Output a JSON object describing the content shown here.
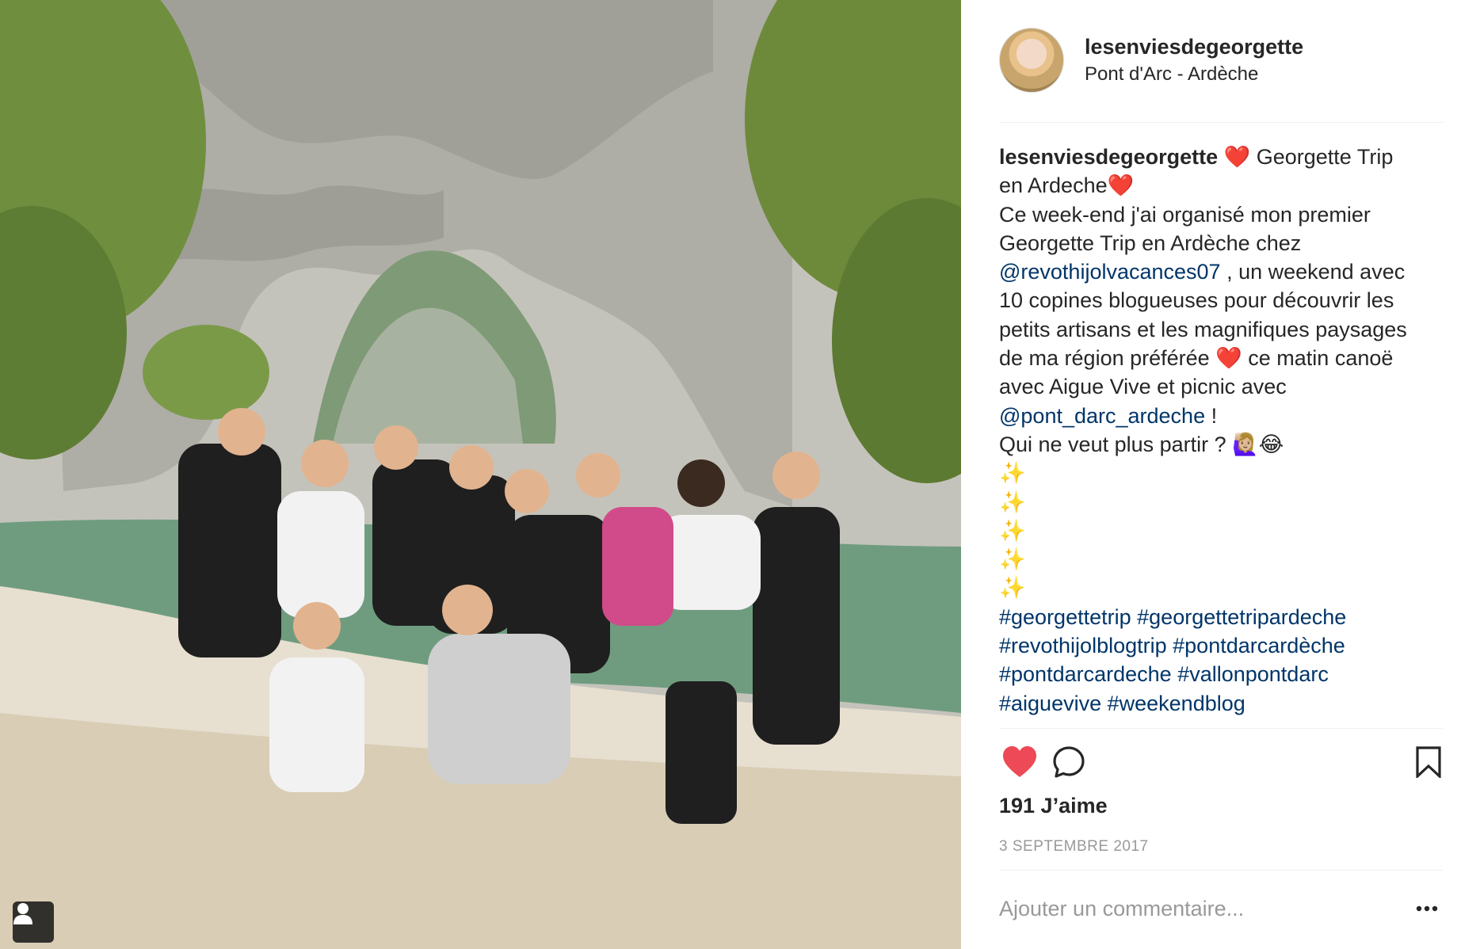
{
  "post": {
    "username": "lesenviesdegeorgette",
    "location": "Pont d'Arc - Ardèche",
    "caption": {
      "lines": [
        [
          {
            "t": "lesenviesdegeorgette",
            "k": "user"
          },
          {
            "t": " ❤️ Georgette Trip"
          }
        ],
        [
          {
            "t": "en Ardeche❤️"
          }
        ],
        [
          {
            "t": "Ce week-end j'ai organisé mon premier"
          }
        ],
        [
          {
            "t": "Georgette Trip en Ardèche chez"
          }
        ],
        [
          {
            "t": "@revothijolvacances07",
            "k": "link"
          },
          {
            "t": " , un weekend avec"
          }
        ],
        [
          {
            "t": "10 copines blogueuses pour découvrir les"
          }
        ],
        [
          {
            "t": "petits artisans et les magnifiques paysages"
          }
        ],
        [
          {
            "t": "de ma région préférée ❤️ ce matin canoë"
          }
        ],
        [
          {
            "t": "avec Aigue Vive et picnic avec"
          }
        ],
        [
          {
            "t": "@pont_darc_ardeche",
            "k": "link"
          },
          {
            "t": " !"
          }
        ],
        [
          {
            "t": "Qui ne veut plus partir ? 🙋🏼‍♀️😂"
          }
        ],
        [
          {
            "t": "✨"
          }
        ],
        [
          {
            "t": "✨"
          }
        ],
        [
          {
            "t": "✨"
          }
        ],
        [
          {
            "t": "✨"
          }
        ],
        [
          {
            "t": "✨"
          }
        ],
        [
          {
            "t": "#georgettetrip",
            "k": "link"
          },
          {
            "t": " "
          },
          {
            "t": "#georgettetripardeche",
            "k": "link"
          }
        ],
        [
          {
            "t": "#revothijolblogtrip",
            "k": "link"
          },
          {
            "t": " "
          },
          {
            "t": "#pontdarcardèche",
            "k": "link"
          }
        ],
        [
          {
            "t": "#pontdarcardeche",
            "k": "link"
          },
          {
            "t": " "
          },
          {
            "t": "#vallonpontdarc",
            "k": "link"
          }
        ],
        [
          {
            "t": "#aiguevive",
            "k": "link"
          },
          {
            "t": " "
          },
          {
            "t": "#weekendblog",
            "k": "link"
          }
        ]
      ]
    },
    "likes_label": "191 J’aime",
    "date_label": "3 SEPTEMBRE 2017",
    "comment_placeholder": "Ajouter un commentaire...",
    "more_label": "•••"
  },
  "icons": {
    "like": "heart-icon",
    "comment": "comment-icon",
    "save": "bookmark-icon",
    "tagged_users": "user-tag-icon",
    "more": "more-options-icon"
  },
  "colors": {
    "like_red": "#ed4956",
    "link_blue": "#003569",
    "muted_gray": "#999999",
    "text": "#262626"
  }
}
